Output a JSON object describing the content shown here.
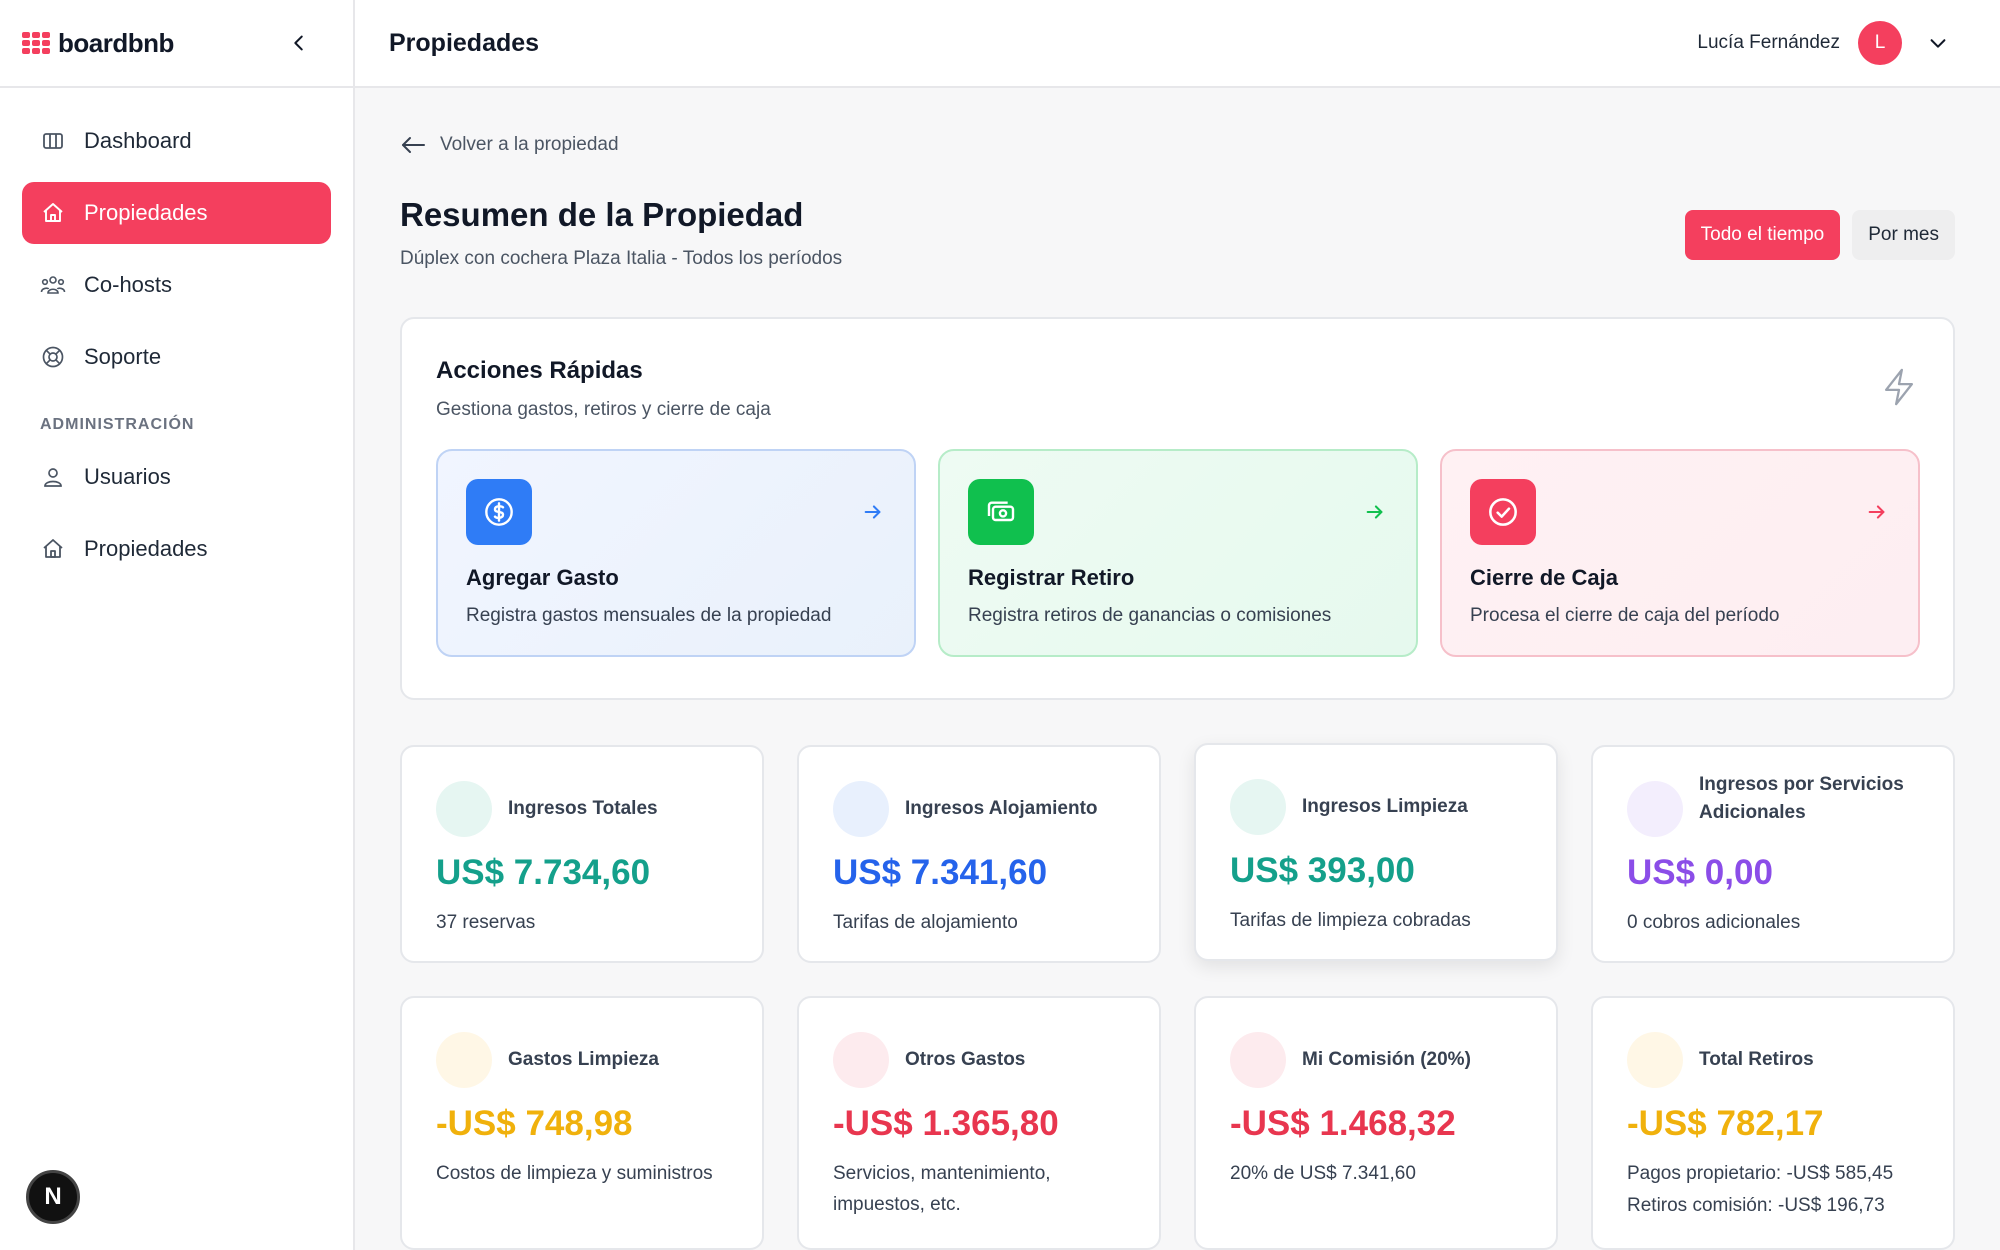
{
  "brand": {
    "name": "boardbnb",
    "accent": "#f43f5e"
  },
  "sidebar": {
    "items": [
      {
        "label": "Dashboard",
        "icon": "columns-icon"
      },
      {
        "label": "Propiedades",
        "icon": "home-icon",
        "active": true
      },
      {
        "label": "Co-hosts",
        "icon": "users-group-icon"
      },
      {
        "label": "Soporte",
        "icon": "lifebuoy-icon"
      }
    ],
    "section_label": "ADMINISTRACIÓN",
    "admin_items": [
      {
        "label": "Usuarios",
        "icon": "users-icon"
      },
      {
        "label": "Propiedades",
        "icon": "home-icon"
      }
    ],
    "badge": "N"
  },
  "header": {
    "title": "Propiedades",
    "user_name": "Lucía Fernández",
    "avatar_initial": "L"
  },
  "page": {
    "back_label": "Volver a la propiedad",
    "title": "Resumen de la Propiedad",
    "subtitle": "Dúplex con cochera Plaza Italia - Todos los períodos",
    "range": {
      "all_time": "Todo el tiempo",
      "monthly": "Por mes",
      "selected": "all_time"
    }
  },
  "quick_actions": {
    "title": "Acciones Rápidas",
    "subtitle": "Gestiona gastos, retiros y cierre de caja",
    "items": [
      {
        "title": "Agregar Gasto",
        "description": "Registra gastos mensuales de la propiedad",
        "icon": "dollar-circle-icon",
        "color": "#2f7cf6"
      },
      {
        "title": "Registrar Retiro",
        "description": "Registra retiros de ganancias o comisiones",
        "icon": "cash-icon",
        "color": "#10c04e"
      },
      {
        "title": "Cierre de Caja",
        "description": "Procesa el cierre de caja del período",
        "icon": "check-circle-icon",
        "color": "#f43f5e"
      }
    ]
  },
  "stats": [
    {
      "label": "Ingresos Totales",
      "value": "US$ 7.734,60",
      "description": "37 reservas",
      "color": "#14a08b"
    },
    {
      "label": "Ingresos Alojamiento",
      "value": "US$ 7.341,60",
      "description": "Tarifas de alojamiento",
      "color": "#2563eb"
    },
    {
      "label": "Ingresos Limpieza",
      "value": "US$ 393,00",
      "description": "Tarifas de limpieza cobradas",
      "color": "#14a08b"
    },
    {
      "label": "Ingresos por Servicios Adicionales",
      "value": "US$ 0,00",
      "description": "0 cobros adicionales",
      "color": "#8b4de8"
    },
    {
      "label": "Gastos Limpieza",
      "value": "-US$ 748,98",
      "description": "Costos de limpieza y suministros",
      "color": "#f0b10c"
    },
    {
      "label": "Otros Gastos",
      "value": "-US$ 1.365,80",
      "description": "Servicios, mantenimiento, impuestos, etc.",
      "color": "#e8364f"
    },
    {
      "label": "Mi Comisión (20%)",
      "value": "-US$ 1.468,32",
      "description": "20% de US$ 7.341,60",
      "color": "#e8364f"
    },
    {
      "label": "Total Retiros",
      "value": "-US$ 782,17",
      "description": "Pagos propietario: -US$ 585,45",
      "description2": "Retiros comisión: -US$ 196,73",
      "color": "#f0b10c"
    }
  ]
}
